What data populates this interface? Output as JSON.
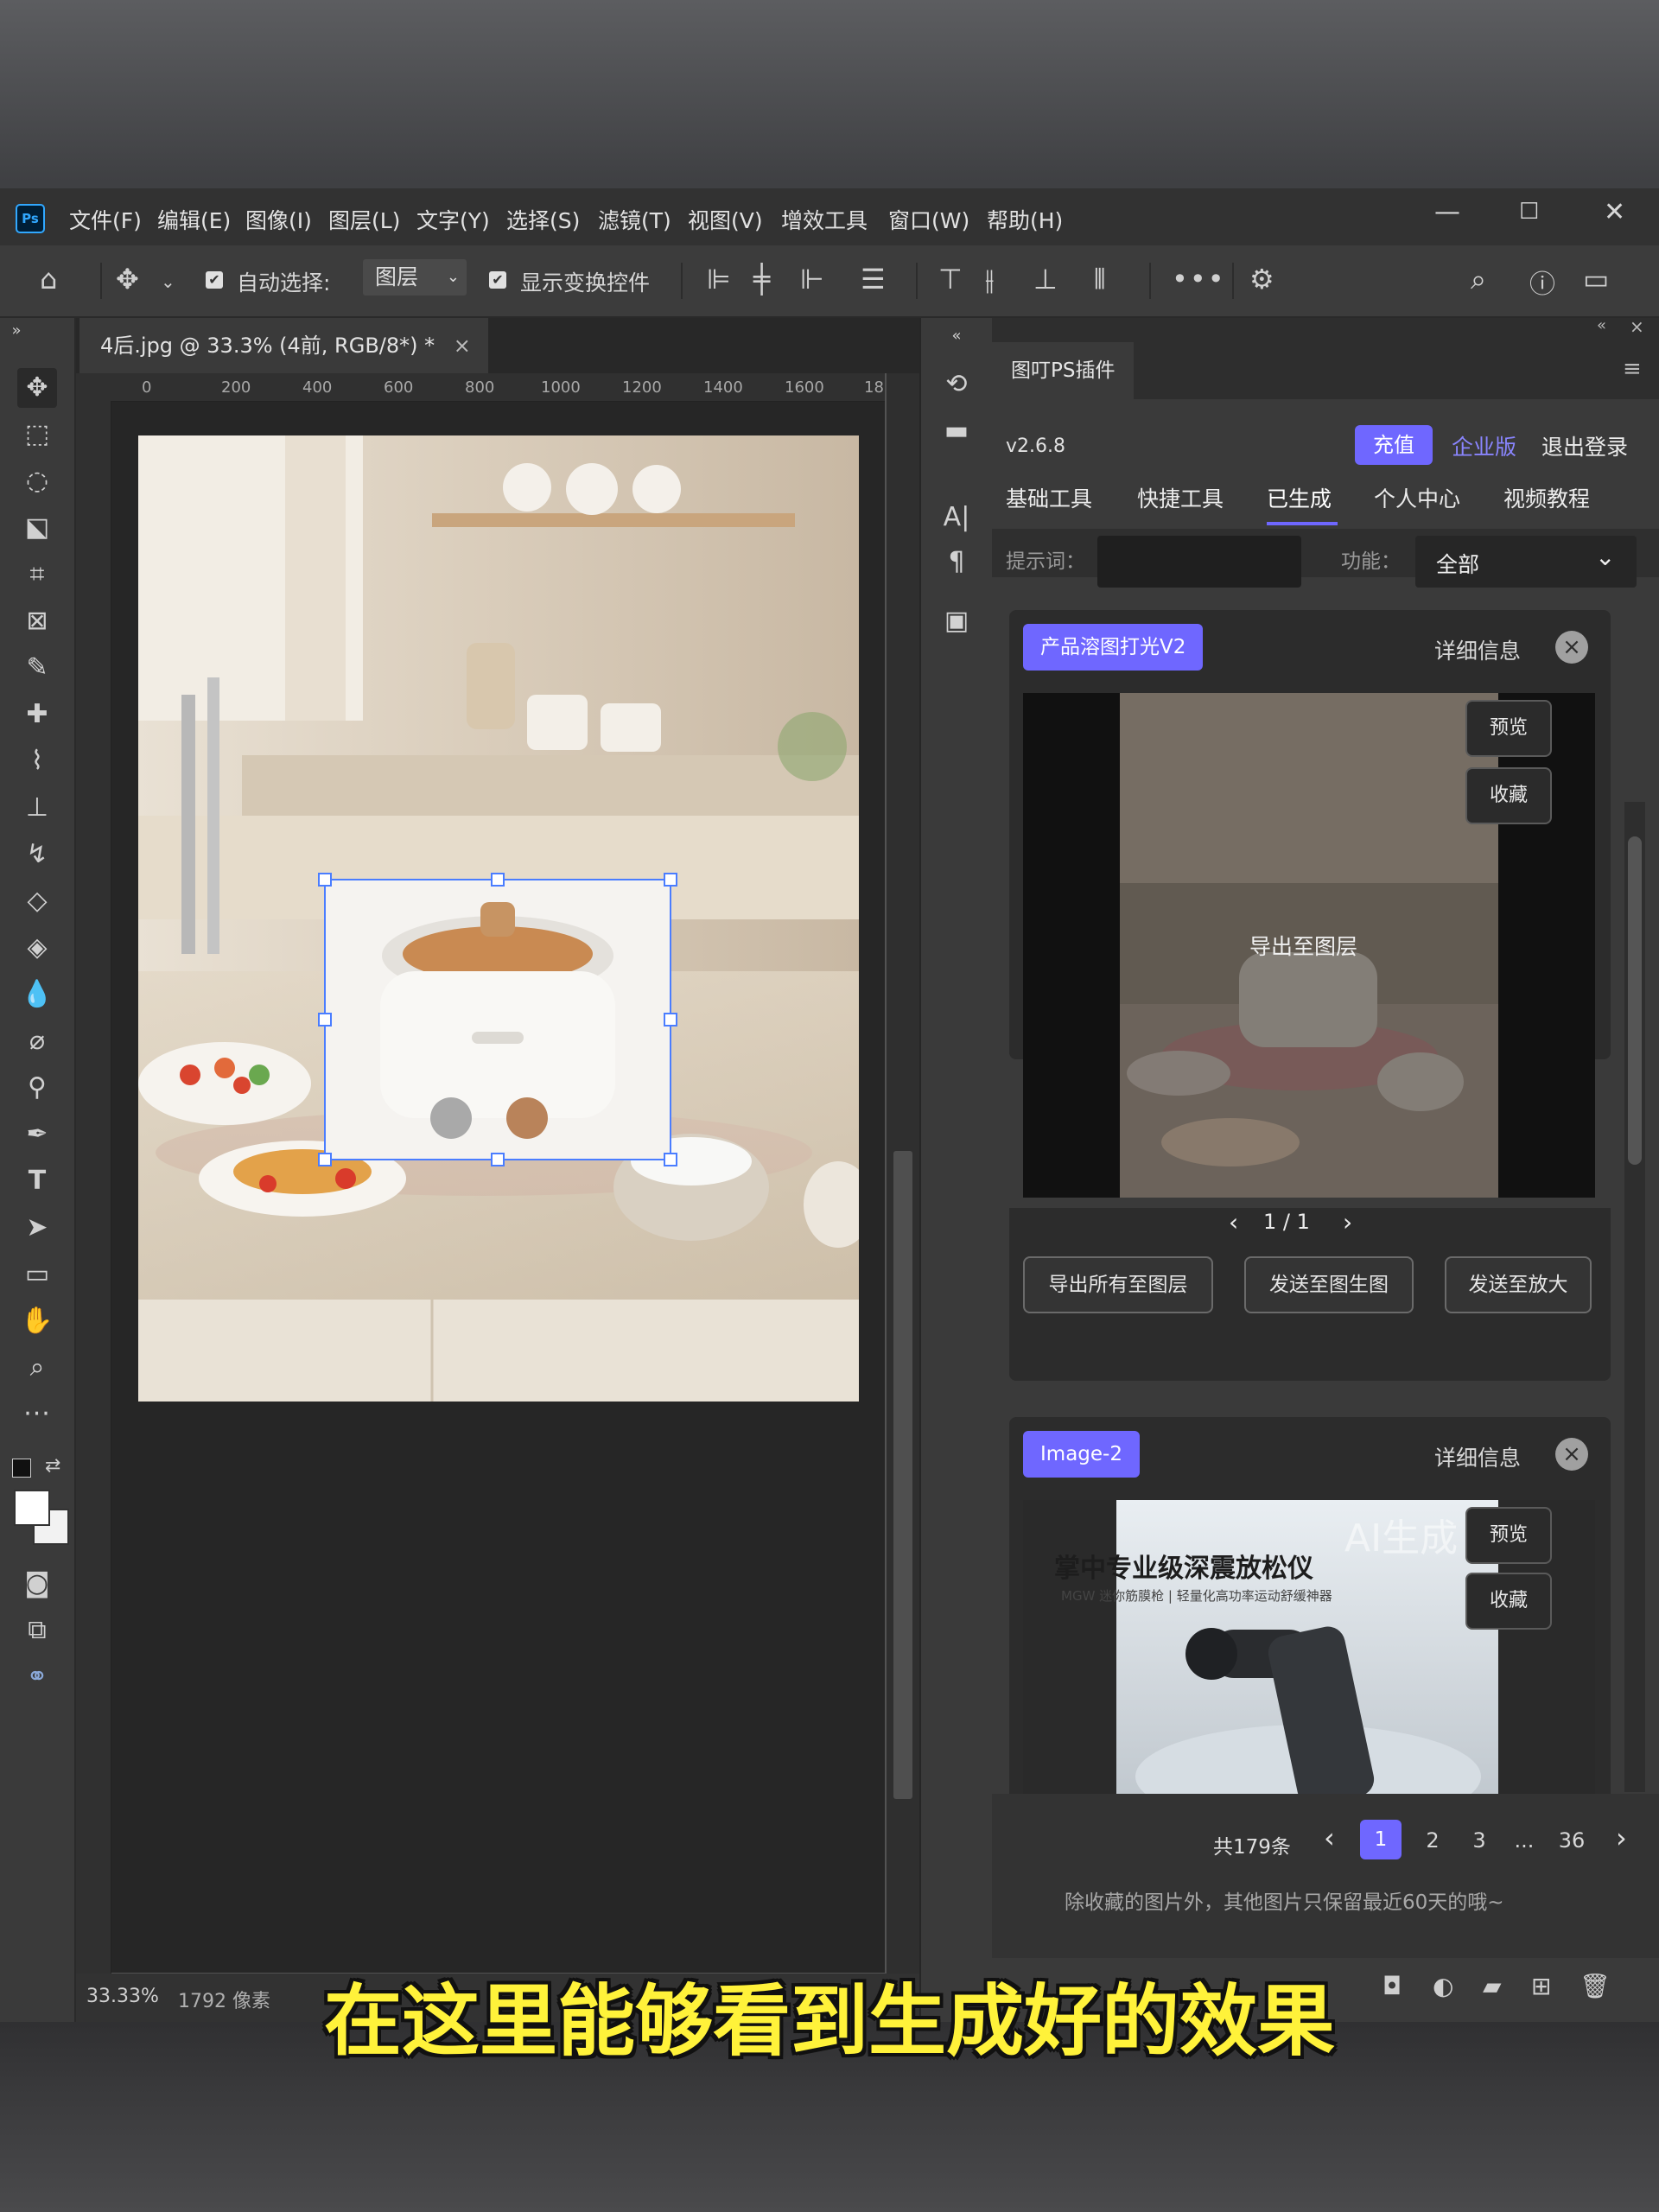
{
  "app": {
    "logo": "Ps",
    "menu": [
      "文件(F)",
      "编辑(E)",
      "图像(I)",
      "图层(L)",
      "文字(Y)",
      "选择(S)",
      "滤镜(T)",
      "视图(V)",
      "增效工具",
      "窗口(W)",
      "帮助(H)"
    ],
    "window_controls": {
      "minimize": "—",
      "maximize": "☐",
      "close": "✕"
    }
  },
  "options": {
    "auto_select_label": "自动选择:",
    "auto_select_value": "图层",
    "show_transform_label": "显示变换控件",
    "more": "•••"
  },
  "document": {
    "tab_title": "4后.jpg @ 33.3% (4前, RGB/8*) *",
    "tab_close": "×",
    "ruler_h": [
      "0",
      "200",
      "400",
      "600",
      "800",
      "1000",
      "1200",
      "1400",
      "1600",
      "18("
    ],
    "zoom": "33.33%",
    "status_info": "1792 像素"
  },
  "plugin": {
    "tab_title": "图叮PS插件",
    "version": "v2.6.8",
    "recharge": "充值",
    "enterprise": "企业版",
    "logout": "退出登录",
    "nav": [
      "基础工具",
      "快捷工具",
      "已生成",
      "个人中心",
      "视频教程"
    ],
    "active_nav": 2,
    "prompt_label": "提示词：",
    "prompt_value": "",
    "function_label": "功能：",
    "function_value": "全部",
    "card1": {
      "badge": "产品溶图打光V2",
      "details": "详细信息",
      "preview": "预览",
      "favorite": "收藏",
      "overlay": "导出至图层",
      "pager": "1 / 1",
      "btn_export_all": "导出所有至图层",
      "btn_send_gen": "发送至图生图",
      "btn_send_upscale": "发送至放大"
    },
    "card2": {
      "badge": "Image-2",
      "details": "详细信息",
      "preview": "预览",
      "favorite": "收藏",
      "watermark": "AI生成",
      "headline": "掌中专业级深震放松仪",
      "subline": "MGW 迷你筋膜枪 | 轻量化高功率运动舒缓神器"
    },
    "pagination": {
      "total": "共179条",
      "pages": [
        "1",
        "2",
        "3",
        "...",
        "36"
      ],
      "current": "1"
    },
    "note": "除收藏的图片外，其他图片只保留最近60天的哦~"
  },
  "subtitle": "在这里能够看到生成好的效果",
  "colors": {
    "accent": "#6f67ff",
    "subtitle": "#fff23a",
    "selection": "#4a7dff"
  }
}
